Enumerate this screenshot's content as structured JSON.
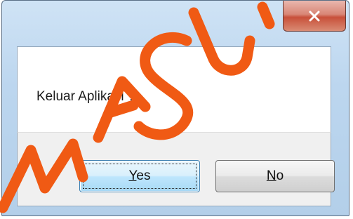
{
  "dialog": {
    "close_glyph": "x",
    "message": "Keluar Aplikasi ?",
    "yes_mnemonic": "Y",
    "yes_rest": "es",
    "no_mnemonic": "N",
    "no_rest": "o"
  },
  "watermark": {
    "text": "MASUK",
    "color": "#f05a14"
  }
}
